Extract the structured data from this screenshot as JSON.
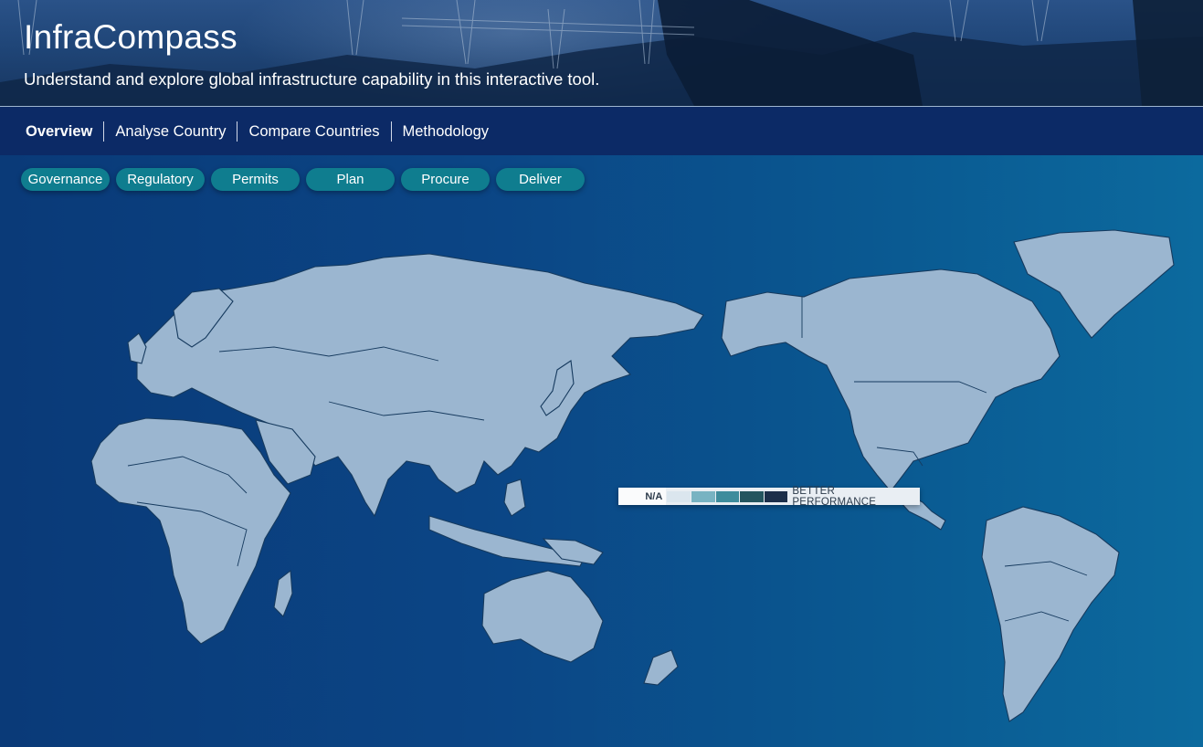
{
  "app": {
    "title": "InfraCompass",
    "subtitle": "Understand and explore global infrastructure capability in this interactive tool."
  },
  "nav": {
    "items": [
      {
        "label": "Overview",
        "active": true
      },
      {
        "label": "Analyse Country",
        "active": false
      },
      {
        "label": "Compare Countries",
        "active": false
      },
      {
        "label": "Methodology",
        "active": false
      }
    ]
  },
  "filters": {
    "pills": [
      "Governance",
      "Regulatory",
      "Permits",
      "Plan",
      "Procure",
      "Deliver"
    ]
  },
  "legend": {
    "na_label": "N/A",
    "high_label": "BETTER PERFORMANCE",
    "scale_colors": [
      "#dbe6ee",
      "#78b3c2",
      "#3e8c9c",
      "#24555f",
      "#1c2f4a"
    ]
  },
  "colors": {
    "accent": "#0f7d8f",
    "nav_bg": "#0c2a66",
    "land": "#9bb6d0",
    "ocean": "#0b4585"
  }
}
